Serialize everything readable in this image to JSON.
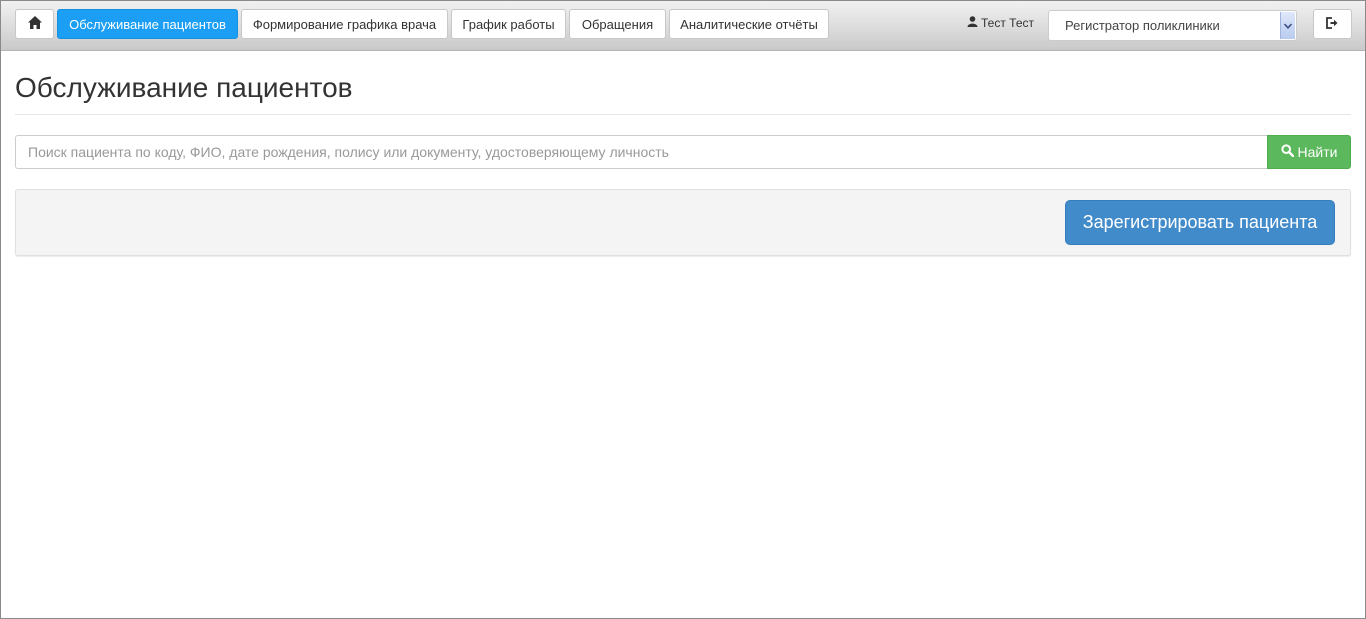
{
  "navbar": {
    "home_icon": "home-icon",
    "tabs": [
      {
        "label": "Обслуживание пациентов",
        "active": true
      },
      {
        "label": "Формирование графика врача",
        "active": false
      },
      {
        "label": "График работы",
        "active": false
      },
      {
        "label": "Обращения",
        "active": false
      },
      {
        "label": "Аналитические отчёты",
        "active": false
      }
    ],
    "user": {
      "icon": "user-icon",
      "name": "Тест Тест"
    },
    "role_select": {
      "value": "Регистратор поликлиники"
    },
    "logout_icon": "logout-icon",
    "active_color": "#1b9ef3"
  },
  "main": {
    "title": "Обслуживание пациентов",
    "search": {
      "placeholder": "Поиск пациента по коду, ФИО, дате рождения, полису или документу, удостоверяющему личность",
      "value": "",
      "button_label": "Найти",
      "button_icon": "search-icon",
      "button_color": "#5cb85c"
    },
    "register_button_label": "Зарегистрировать пациента",
    "register_button_color": "#428bca"
  }
}
